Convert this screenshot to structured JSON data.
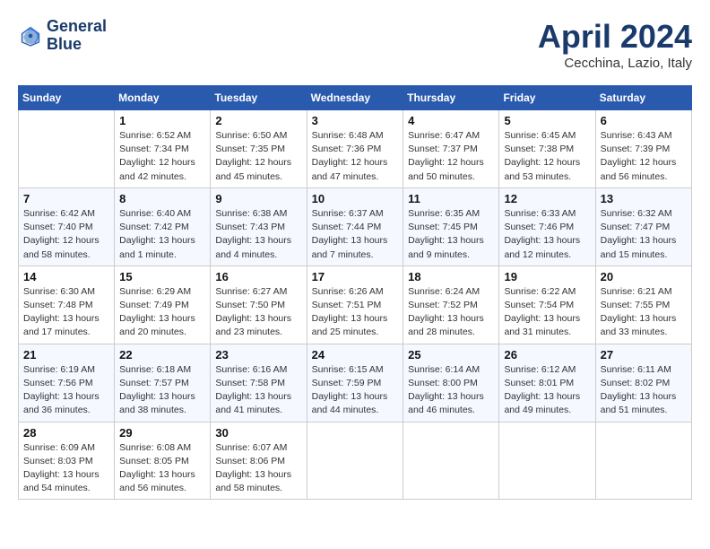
{
  "header": {
    "logo_line1": "General",
    "logo_line2": "Blue",
    "month": "April 2024",
    "location": "Cecchina, Lazio, Italy"
  },
  "weekdays": [
    "Sunday",
    "Monday",
    "Tuesday",
    "Wednesday",
    "Thursday",
    "Friday",
    "Saturday"
  ],
  "weeks": [
    [
      {
        "day": "",
        "sunrise": "",
        "sunset": "",
        "daylight": ""
      },
      {
        "day": "1",
        "sunrise": "Sunrise: 6:52 AM",
        "sunset": "Sunset: 7:34 PM",
        "daylight": "Daylight: 12 hours and 42 minutes."
      },
      {
        "day": "2",
        "sunrise": "Sunrise: 6:50 AM",
        "sunset": "Sunset: 7:35 PM",
        "daylight": "Daylight: 12 hours and 45 minutes."
      },
      {
        "day": "3",
        "sunrise": "Sunrise: 6:48 AM",
        "sunset": "Sunset: 7:36 PM",
        "daylight": "Daylight: 12 hours and 47 minutes."
      },
      {
        "day": "4",
        "sunrise": "Sunrise: 6:47 AM",
        "sunset": "Sunset: 7:37 PM",
        "daylight": "Daylight: 12 hours and 50 minutes."
      },
      {
        "day": "5",
        "sunrise": "Sunrise: 6:45 AM",
        "sunset": "Sunset: 7:38 PM",
        "daylight": "Daylight: 12 hours and 53 minutes."
      },
      {
        "day": "6",
        "sunrise": "Sunrise: 6:43 AM",
        "sunset": "Sunset: 7:39 PM",
        "daylight": "Daylight: 12 hours and 56 minutes."
      }
    ],
    [
      {
        "day": "7",
        "sunrise": "Sunrise: 6:42 AM",
        "sunset": "Sunset: 7:40 PM",
        "daylight": "Daylight: 12 hours and 58 minutes."
      },
      {
        "day": "8",
        "sunrise": "Sunrise: 6:40 AM",
        "sunset": "Sunset: 7:42 PM",
        "daylight": "Daylight: 13 hours and 1 minute."
      },
      {
        "day": "9",
        "sunrise": "Sunrise: 6:38 AM",
        "sunset": "Sunset: 7:43 PM",
        "daylight": "Daylight: 13 hours and 4 minutes."
      },
      {
        "day": "10",
        "sunrise": "Sunrise: 6:37 AM",
        "sunset": "Sunset: 7:44 PM",
        "daylight": "Daylight: 13 hours and 7 minutes."
      },
      {
        "day": "11",
        "sunrise": "Sunrise: 6:35 AM",
        "sunset": "Sunset: 7:45 PM",
        "daylight": "Daylight: 13 hours and 9 minutes."
      },
      {
        "day": "12",
        "sunrise": "Sunrise: 6:33 AM",
        "sunset": "Sunset: 7:46 PM",
        "daylight": "Daylight: 13 hours and 12 minutes."
      },
      {
        "day": "13",
        "sunrise": "Sunrise: 6:32 AM",
        "sunset": "Sunset: 7:47 PM",
        "daylight": "Daylight: 13 hours and 15 minutes."
      }
    ],
    [
      {
        "day": "14",
        "sunrise": "Sunrise: 6:30 AM",
        "sunset": "Sunset: 7:48 PM",
        "daylight": "Daylight: 13 hours and 17 minutes."
      },
      {
        "day": "15",
        "sunrise": "Sunrise: 6:29 AM",
        "sunset": "Sunset: 7:49 PM",
        "daylight": "Daylight: 13 hours and 20 minutes."
      },
      {
        "day": "16",
        "sunrise": "Sunrise: 6:27 AM",
        "sunset": "Sunset: 7:50 PM",
        "daylight": "Daylight: 13 hours and 23 minutes."
      },
      {
        "day": "17",
        "sunrise": "Sunrise: 6:26 AM",
        "sunset": "Sunset: 7:51 PM",
        "daylight": "Daylight: 13 hours and 25 minutes."
      },
      {
        "day": "18",
        "sunrise": "Sunrise: 6:24 AM",
        "sunset": "Sunset: 7:52 PM",
        "daylight": "Daylight: 13 hours and 28 minutes."
      },
      {
        "day": "19",
        "sunrise": "Sunrise: 6:22 AM",
        "sunset": "Sunset: 7:54 PM",
        "daylight": "Daylight: 13 hours and 31 minutes."
      },
      {
        "day": "20",
        "sunrise": "Sunrise: 6:21 AM",
        "sunset": "Sunset: 7:55 PM",
        "daylight": "Daylight: 13 hours and 33 minutes."
      }
    ],
    [
      {
        "day": "21",
        "sunrise": "Sunrise: 6:19 AM",
        "sunset": "Sunset: 7:56 PM",
        "daylight": "Daylight: 13 hours and 36 minutes."
      },
      {
        "day": "22",
        "sunrise": "Sunrise: 6:18 AM",
        "sunset": "Sunset: 7:57 PM",
        "daylight": "Daylight: 13 hours and 38 minutes."
      },
      {
        "day": "23",
        "sunrise": "Sunrise: 6:16 AM",
        "sunset": "Sunset: 7:58 PM",
        "daylight": "Daylight: 13 hours and 41 minutes."
      },
      {
        "day": "24",
        "sunrise": "Sunrise: 6:15 AM",
        "sunset": "Sunset: 7:59 PM",
        "daylight": "Daylight: 13 hours and 44 minutes."
      },
      {
        "day": "25",
        "sunrise": "Sunrise: 6:14 AM",
        "sunset": "Sunset: 8:00 PM",
        "daylight": "Daylight: 13 hours and 46 minutes."
      },
      {
        "day": "26",
        "sunrise": "Sunrise: 6:12 AM",
        "sunset": "Sunset: 8:01 PM",
        "daylight": "Daylight: 13 hours and 49 minutes."
      },
      {
        "day": "27",
        "sunrise": "Sunrise: 6:11 AM",
        "sunset": "Sunset: 8:02 PM",
        "daylight": "Daylight: 13 hours and 51 minutes."
      }
    ],
    [
      {
        "day": "28",
        "sunrise": "Sunrise: 6:09 AM",
        "sunset": "Sunset: 8:03 PM",
        "daylight": "Daylight: 13 hours and 54 minutes."
      },
      {
        "day": "29",
        "sunrise": "Sunrise: 6:08 AM",
        "sunset": "Sunset: 8:05 PM",
        "daylight": "Daylight: 13 hours and 56 minutes."
      },
      {
        "day": "30",
        "sunrise": "Sunrise: 6:07 AM",
        "sunset": "Sunset: 8:06 PM",
        "daylight": "Daylight: 13 hours and 58 minutes."
      },
      {
        "day": "",
        "sunrise": "",
        "sunset": "",
        "daylight": ""
      },
      {
        "day": "",
        "sunrise": "",
        "sunset": "",
        "daylight": ""
      },
      {
        "day": "",
        "sunrise": "",
        "sunset": "",
        "daylight": ""
      },
      {
        "day": "",
        "sunrise": "",
        "sunset": "",
        "daylight": ""
      }
    ]
  ]
}
